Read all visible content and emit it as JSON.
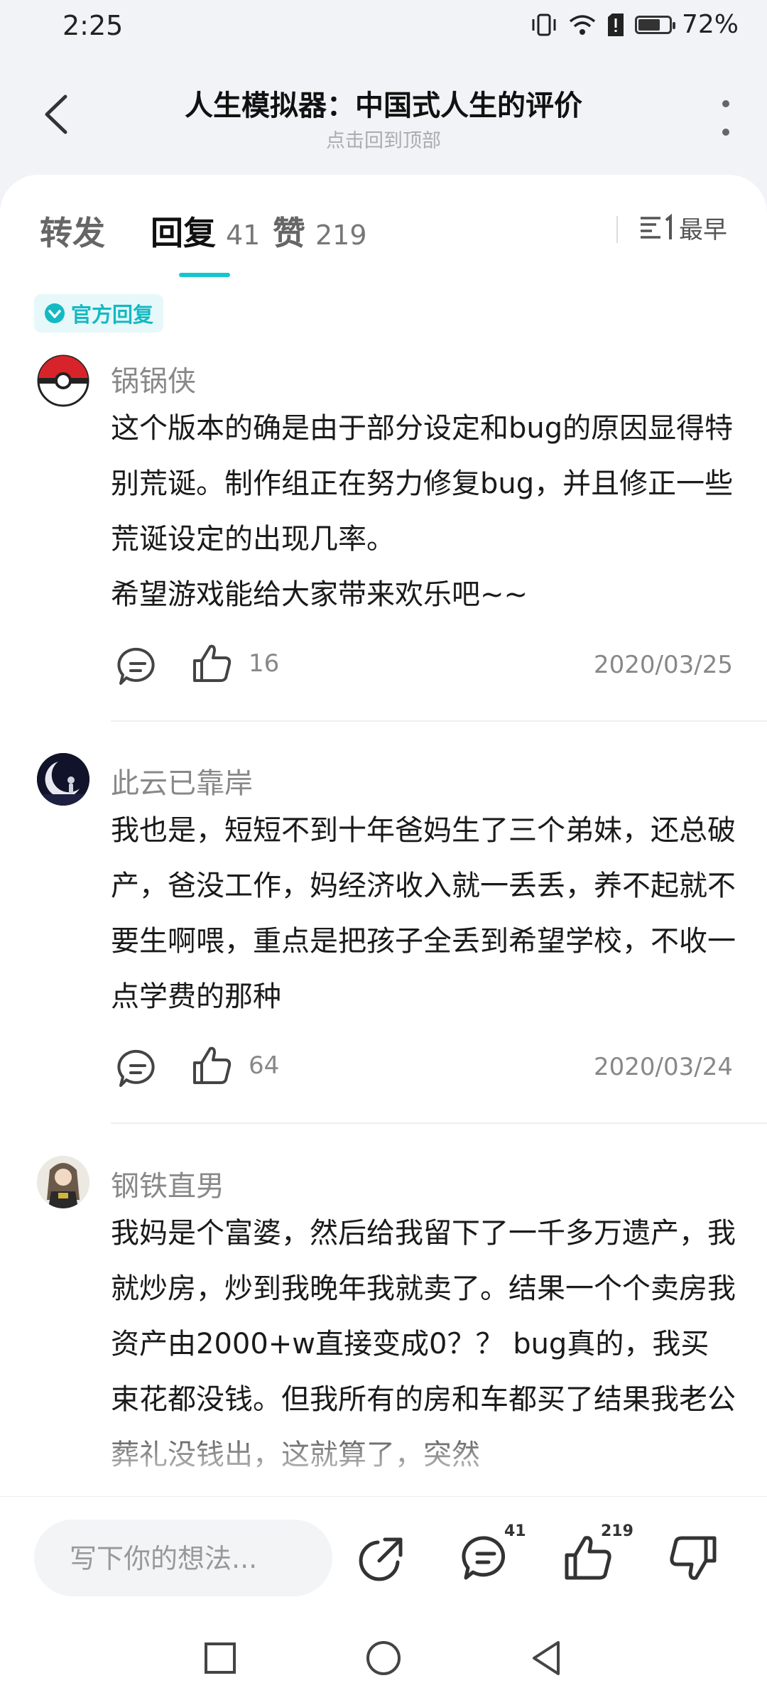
{
  "status": {
    "time": "2:25",
    "battery": "72%",
    "battery_level": 0.72
  },
  "header": {
    "title": "人生模拟器：中国式人生的评价",
    "subtitle": "点击回到顶部"
  },
  "tabs": [
    {
      "label": "转发",
      "count": ""
    },
    {
      "label": "回复",
      "count": "41"
    },
    {
      "label": "赞",
      "count": "219"
    }
  ],
  "sort": {
    "label": "最早"
  },
  "official_badge": "官方回复",
  "comments": [
    {
      "username": "锅锅侠",
      "body": "这个版本的确是由于部分设定和bug的原因显得特别荒诞。制作组正在努力修复bug，并且修正一些荒诞设定的出现几率。\n希望游戏能给大家带来欢乐吧~~",
      "likes": "16",
      "date": "2020/03/25"
    },
    {
      "username": "此云已靠岸",
      "body": "我也是，短短不到十年爸妈生了三个弟妹，还总破产，爸没工作，妈经济收入就一丢丢，养不起就不要生啊喂，重点是把孩子全丢到希望学校，不收一点学费的那种",
      "likes": "64",
      "date": "2020/03/24"
    },
    {
      "username": "钢铁直男",
      "body": "我妈是个富婆，然后给我留下了一千多万遗产，我就炒房，炒到我晚年我就卖了。结果一个个卖房我资产由2000+w直接变成0？？ bug真的，我买束花都没钱。但我所有的房和车都买了结果我老公葬礼没钱出，这就算了，突然",
      "likes": "",
      "date": ""
    }
  ],
  "bottom_bar": {
    "placeholder": "写下你的想法...",
    "reply_count": "41",
    "like_count": "219"
  },
  "colors": {
    "accent": "#15c5ce",
    "background": "#f1f3f6",
    "card": "#ffffff"
  }
}
